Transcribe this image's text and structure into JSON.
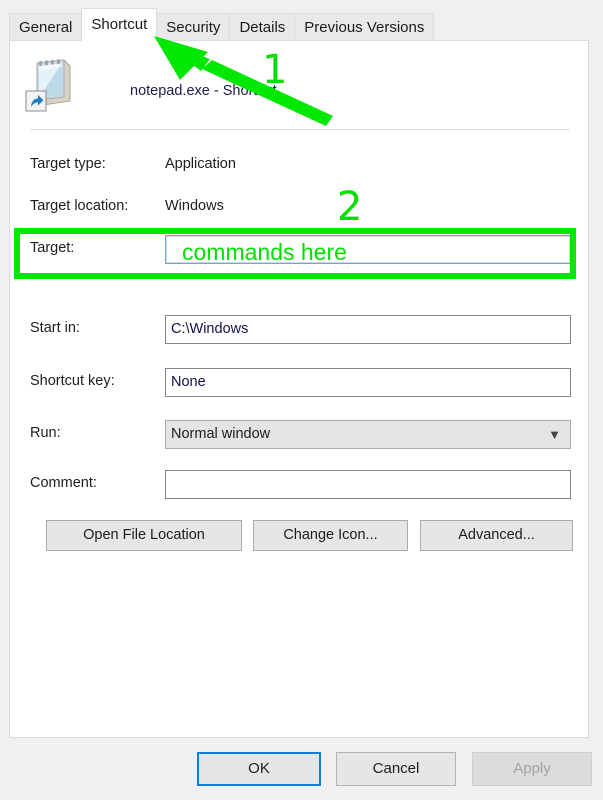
{
  "dialog": {
    "tabs": [
      {
        "label": "General",
        "active": false
      },
      {
        "label": "Shortcut",
        "active": true
      },
      {
        "label": "Security",
        "active": false
      },
      {
        "label": "Details",
        "active": false
      },
      {
        "label": "Previous Versions",
        "active": false
      }
    ],
    "header": {
      "icon": "notepad-shortcut-icon",
      "title": "notepad.exe - Shortcut"
    },
    "fields": {
      "target_type": {
        "label": "Target type:",
        "value": "Application"
      },
      "target_location": {
        "label": "Target location:",
        "value": "Windows"
      },
      "target": {
        "label": "Target:",
        "value": "",
        "placeholder": ""
      },
      "start_in": {
        "label": "Start in:",
        "value": "C:\\Windows"
      },
      "shortcut_key": {
        "label": "Shortcut key:",
        "value": "None"
      },
      "run": {
        "label": "Run:",
        "value": "Normal window",
        "icon": "chevron-down-icon"
      },
      "comment": {
        "label": "Comment:",
        "value": ""
      }
    },
    "actions": {
      "open_file_location": "Open File Location",
      "change_icon": "Change Icon...",
      "advanced": "Advanced..."
    },
    "footer": {
      "ok": "OK",
      "cancel": "Cancel",
      "apply": "Apply"
    }
  },
  "annotations": {
    "color": "#00e000",
    "step_one": "1",
    "step_two": "2",
    "target_overlay_text": "commands here",
    "arrow": "arrow-pointing-to-shortcut-tab"
  }
}
